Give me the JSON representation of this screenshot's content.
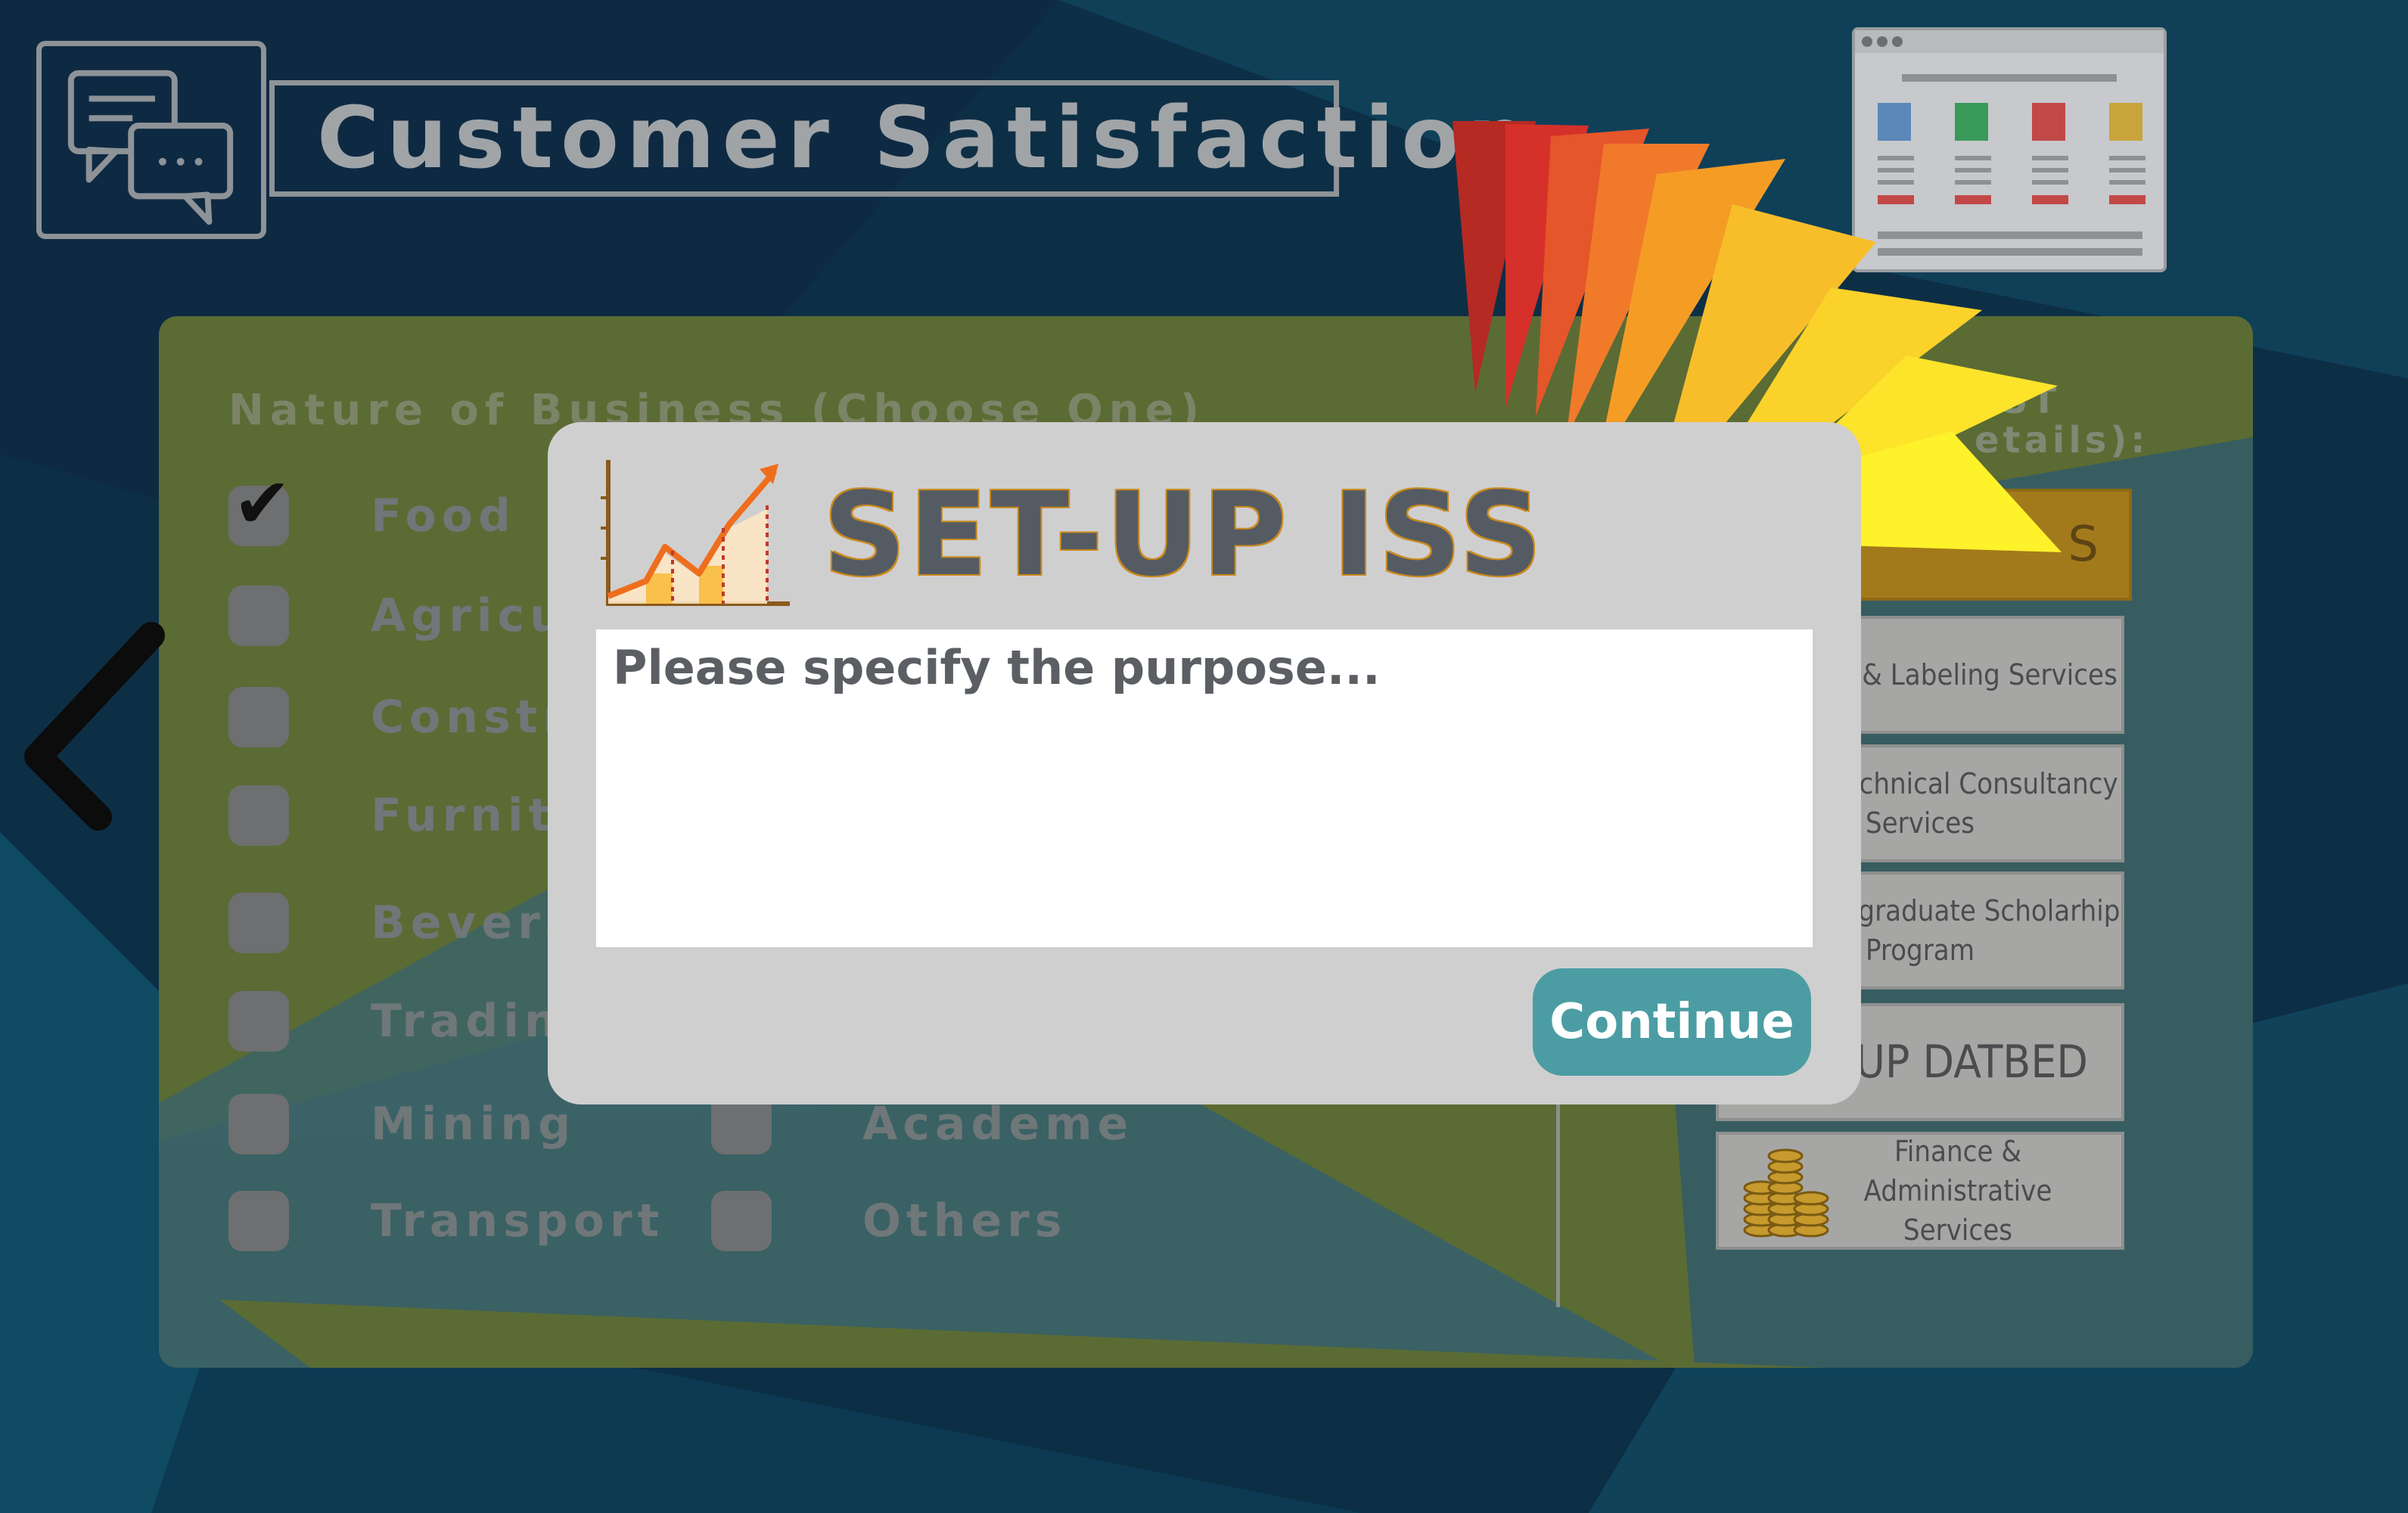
{
  "header": {
    "title": "Customer Satisfaction"
  },
  "form": {
    "nature_heading": "Nature of Business (Choose One)",
    "right_heading_line1": "OST",
    "right_heading_line2": "etails):",
    "options_left": [
      {
        "label": "Food",
        "checked": true
      },
      {
        "label": "Agricult",
        "checked": false
      },
      {
        "label": "Constru",
        "checked": false
      },
      {
        "label": "Furnitu",
        "checked": false
      },
      {
        "label": "Beverag",
        "checked": false
      },
      {
        "label": "Trading",
        "checked": false
      },
      {
        "label": "Mining",
        "checked": false
      },
      {
        "label": "Transport",
        "checked": false
      }
    ],
    "options_right": [
      {
        "label": "Academe",
        "checked": false
      },
      {
        "label": "Others",
        "checked": false
      }
    ]
  },
  "services": {
    "accent_partial": "S",
    "items": [
      "Packaging & Labeling Services",
      "Training/Technical Consultancy Services",
      "S&T Undergraduate Scholarhip Program",
      "ET-UP DATBED",
      "Finance & Administrative Services"
    ]
  },
  "modal": {
    "title": "SET-UP ISS",
    "input_placeholder": "Please specify the purpose...",
    "continue_label": "Continue"
  },
  "colors": {
    "modal_bg": "#d0cfd0",
    "continue_bg": "#4b9da3",
    "panel_bg": "#5b6b34",
    "page_bg": "#0d3148"
  }
}
